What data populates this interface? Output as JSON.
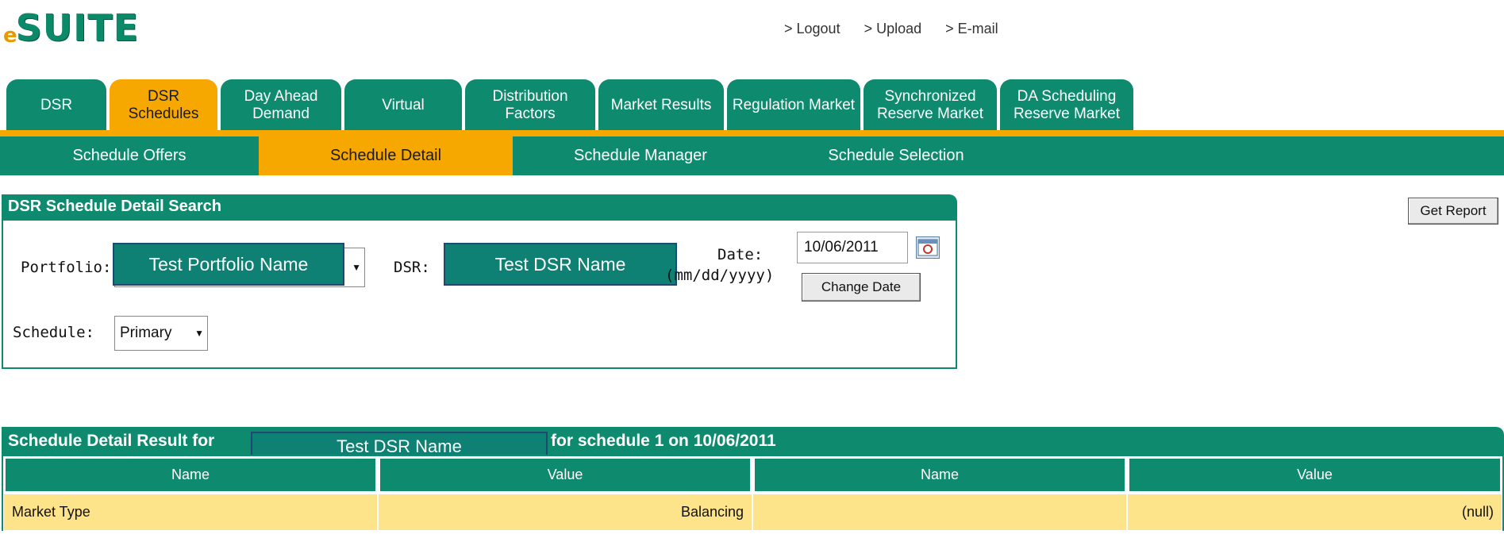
{
  "logo": {
    "prefix": "e",
    "name": "SUITE"
  },
  "top_links": [
    {
      "label": "> Logout"
    },
    {
      "label": "> Upload"
    },
    {
      "label": "> E-mail"
    }
  ],
  "main_tabs": [
    {
      "label": "DSR",
      "active": false
    },
    {
      "label": "DSR Schedules",
      "active": true
    },
    {
      "label": "Day Ahead Demand",
      "active": false
    },
    {
      "label": "Virtual",
      "active": false
    },
    {
      "label": "Distribution Factors",
      "active": false
    },
    {
      "label": "Market Results",
      "active": false
    },
    {
      "label": "Regulation Market",
      "active": false
    },
    {
      "label": "Synchronized Reserve Market",
      "active": false
    },
    {
      "label": "DA Scheduling Reserve Market",
      "active": false
    }
  ],
  "sub_tabs": [
    {
      "label": "Schedule Offers",
      "active": false
    },
    {
      "label": "Schedule Detail",
      "active": true
    },
    {
      "label": "Schedule Manager",
      "active": false
    },
    {
      "label": "Schedule Selection",
      "active": false
    }
  ],
  "search_panel": {
    "title": "DSR Schedule Detail Search",
    "portfolio_label": "Portfolio:",
    "portfolio_value": "Test Portfolio Name",
    "dsr_label": "DSR:",
    "dsr_value": "Test DSR Name",
    "date_label": "Date:",
    "date_format": "(mm/dd/yyyy)",
    "date_value": "10/06/2011",
    "change_date_button": "Change Date",
    "schedule_label": "Schedule:",
    "schedule_value": "Primary",
    "calendar_icon": "calendar-icon"
  },
  "get_report_button": "Get Report",
  "results": {
    "title_prefix": "Schedule Detail Result for",
    "title_dsr": "Test DSR Name",
    "title_suffix": "for schedule 1 on 10/06/2011",
    "columns": [
      "Name",
      "Value",
      "Name",
      "Value"
    ],
    "rows": [
      [
        "Market Type",
        "Balancing",
        "",
        "(null)"
      ]
    ]
  },
  "colors": {
    "primary": "#0e8b6f",
    "accent": "#f7a800",
    "row_bg": "#fde38a"
  }
}
